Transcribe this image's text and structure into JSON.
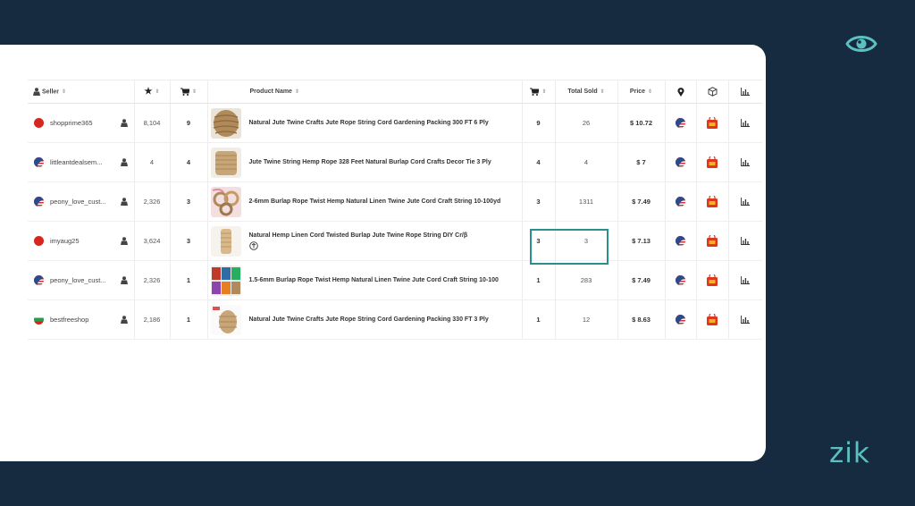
{
  "brand": {
    "name": "zik"
  },
  "colors": {
    "background": "#162b40",
    "accent": "#5bc0c0",
    "highlight": "#2a8f8f"
  },
  "table": {
    "headers": {
      "seller": "Seller",
      "rating_icon": "star-icon",
      "cart_icon": "cart-icon",
      "product_name": "Product Name",
      "product_cart_icon": "cart-icon",
      "total_sold": "Total Sold",
      "price": "Price",
      "location_icon": "location-pin-icon",
      "package_icon": "package-icon",
      "chart_icon": "bar-chart-icon",
      "sort_icon": "sort-icon",
      "seller_icon": "person-icon"
    },
    "rows": [
      {
        "seller": "shopprime365",
        "seller_flag": "china",
        "feedback": "8,104",
        "seller_sales": "9",
        "product": "Natural Jute Twine Crafts Jute Rope String Cord Gardening Packing 300 FT 6 Ply",
        "product_sales": "9",
        "total_sold": "26",
        "price": "$ 10.72"
      },
      {
        "seller": "littleantdealsem...",
        "seller_flag": "usa",
        "feedback": "4",
        "seller_sales": "4",
        "product": "Jute Twine String Hemp Rope 328 Feet Natural Burlap Cord Crafts Decor Tie 3 Ply",
        "product_sales": "4",
        "total_sold": "4",
        "price": "$ 7"
      },
      {
        "seller": "peony_love_cust...",
        "seller_flag": "usa",
        "feedback": "2,326",
        "seller_sales": "3",
        "product": "2-6mm Burlap Rope Twist Hemp Natural Linen Twine Jute Cord Craft String 10-100yd",
        "product_sales": "3",
        "total_sold": "1311",
        "price": "$ 7.49"
      },
      {
        "seller": "imyaug25",
        "seller_flag": "china",
        "feedback": "3,624",
        "seller_sales": "3",
        "product": "Natural Hemp Linen Cord Twisted Burlap Jute Twine Rope String DIY Cr/β",
        "product_sales": "3",
        "total_sold": "3",
        "price": "$ 7.13"
      },
      {
        "seller": "peony_love_cust...",
        "seller_flag": "usa",
        "feedback": "2,326",
        "seller_sales": "1",
        "product": "1.5-6mm Burlap Rope Twist Hemp Natural Linen Twine Jute Cord Craft String 10-100",
        "product_sales": "1",
        "total_sold": "283",
        "price": "$ 7.49"
      },
      {
        "seller": "bestfreeshop",
        "seller_flag": "bulgaria",
        "feedback": "2,186",
        "seller_sales": "1",
        "product": "Natural Jute Twine Crafts Jute Rope String Cord Gardening Packing 330 FT 3 Ply",
        "product_sales": "1",
        "total_sold": "12",
        "price": "$ 8.63"
      }
    ]
  }
}
